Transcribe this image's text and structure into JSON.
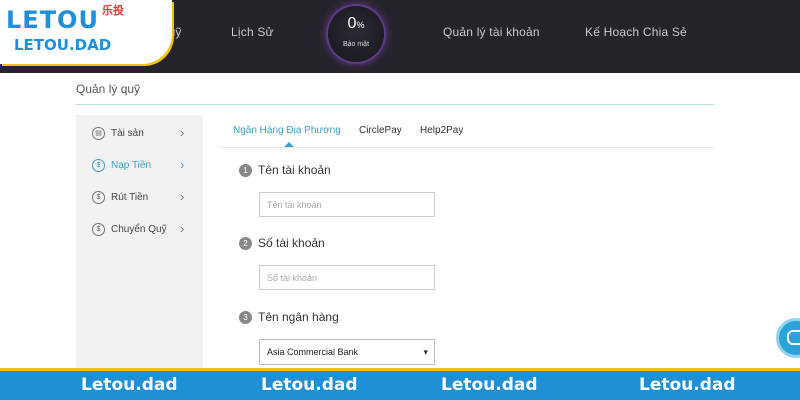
{
  "logo": {
    "main": "LETOU",
    "cn": "乐投",
    "sub": "LETOU.DAD"
  },
  "nav": {
    "fragment": "y Quỹ",
    "items": [
      "Lịch Sử",
      "Quản lý tài khoản",
      "Kế Hoạch Chia Sẻ"
    ],
    "badge": {
      "value": "0",
      "unit": "%",
      "label": "Bảo mật"
    }
  },
  "page": {
    "title": "Quản lý quỹ"
  },
  "sidebar": {
    "items": [
      {
        "icon": "wallet-icon",
        "label": "Tài sản"
      },
      {
        "icon": "deposit-icon",
        "label": "Nạp Tiền",
        "active": true
      },
      {
        "icon": "withdraw-icon",
        "label": "Rút Tiền"
      },
      {
        "icon": "transfer-icon",
        "label": "Chuyển Quỹ"
      }
    ]
  },
  "tabs": [
    "Ngân Hàng Địa Phương",
    "CirclePay",
    "Help2Pay"
  ],
  "form": {
    "steps": [
      {
        "num": "1",
        "label": "Tên tài khoản",
        "placeholder": "Tên tài khoản"
      },
      {
        "num": "2",
        "label": "Số tài khoản",
        "placeholder": "Số tài khoản"
      },
      {
        "num": "3",
        "label": "Tên ngân hàng"
      }
    ],
    "bank_selected": "Asia Commercial Bank"
  },
  "watermark": "Letou.dad",
  "colors": {
    "accent": "#3ba0c8",
    "brand": "#1e8fd8",
    "band": "#1f8fd6",
    "gold": "#f1c200"
  }
}
